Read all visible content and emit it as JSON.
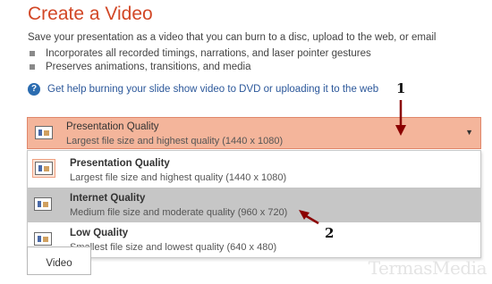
{
  "header": {
    "title": "Create a Video",
    "description": "Save your presentation as a video that you can burn to a disc, upload to the web, or email"
  },
  "bullets": [
    "Incorporates all recorded timings, narrations, and laser pointer gestures",
    "Preserves animations, transitions, and media"
  ],
  "help": {
    "icon": "help-circle-icon",
    "text": "Get help burning your slide show video to DVD or uploading it to the web"
  },
  "quality_select": {
    "selected": {
      "name": "Presentation Quality",
      "detail": "Largest file size and highest quality (1440 x 1080)"
    },
    "options": [
      {
        "name": "Presentation Quality",
        "detail": "Largest file size and highest quality (1440 x 1080)"
      },
      {
        "name": "Internet Quality",
        "detail": "Medium file size and moderate quality (960 x 720)"
      },
      {
        "name": "Low Quality",
        "detail": "Smallest file size and lowest quality (640 x 480)"
      }
    ]
  },
  "create_button": {
    "label": "Video"
  },
  "annotations": {
    "marker1": "1",
    "marker2": "2"
  },
  "watermark": "TermasMedia",
  "colors": {
    "accent": "#d24726",
    "selected_field": "#f4b59b",
    "hover_option": "#c6c6c6",
    "link": "#2b579a",
    "annotation_arrow": "#8b0000"
  }
}
